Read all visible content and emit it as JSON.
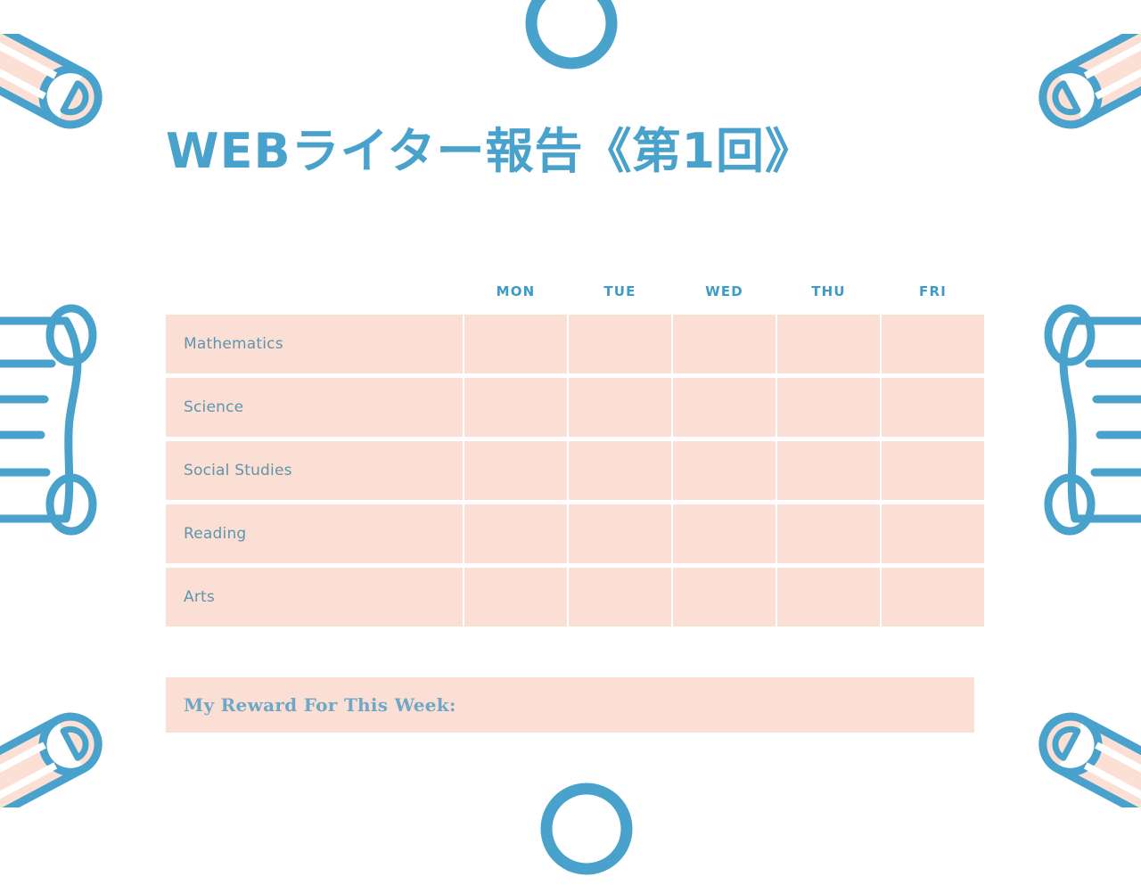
{
  "document": {
    "title": "WEBライター報告《第1回》",
    "background_color": "#FFFFFF",
    "accent_blue": "#49A2CB",
    "cell_peach": "#FCDFD4",
    "label_blue": "#5E95AD"
  },
  "table": {
    "row_header_label": "",
    "columns": [
      "MON",
      "TUE",
      "WED",
      "THU",
      "FRI"
    ],
    "rows": [
      {
        "subject": "Mathematics",
        "values": [
          "",
          "",
          "",
          "",
          ""
        ]
      },
      {
        "subject": "Science",
        "values": [
          "",
          "",
          "",
          "",
          ""
        ]
      },
      {
        "subject": "Social Studies",
        "values": [
          "",
          "",
          "",
          "",
          ""
        ]
      },
      {
        "subject": "Reading",
        "values": [
          "",
          "",
          "",
          "",
          ""
        ]
      },
      {
        "subject": "Arts",
        "values": [
          "",
          "",
          "",
          "",
          ""
        ]
      }
    ]
  },
  "reward": {
    "label": "My Reward For This Week:",
    "value": ""
  },
  "decorations": [
    {
      "name": "pencil-icon",
      "position": "top-left"
    },
    {
      "name": "pencil-icon",
      "position": "top-right"
    },
    {
      "name": "pencil-icon",
      "position": "bottom-left"
    },
    {
      "name": "pencil-icon",
      "position": "bottom-right"
    },
    {
      "name": "scroll-icon",
      "position": "middle-left"
    },
    {
      "name": "scroll-icon",
      "position": "middle-right"
    },
    {
      "name": "circle-outline-icon",
      "position": "top-center"
    },
    {
      "name": "circle-outline-icon",
      "position": "bottom-center"
    }
  ]
}
